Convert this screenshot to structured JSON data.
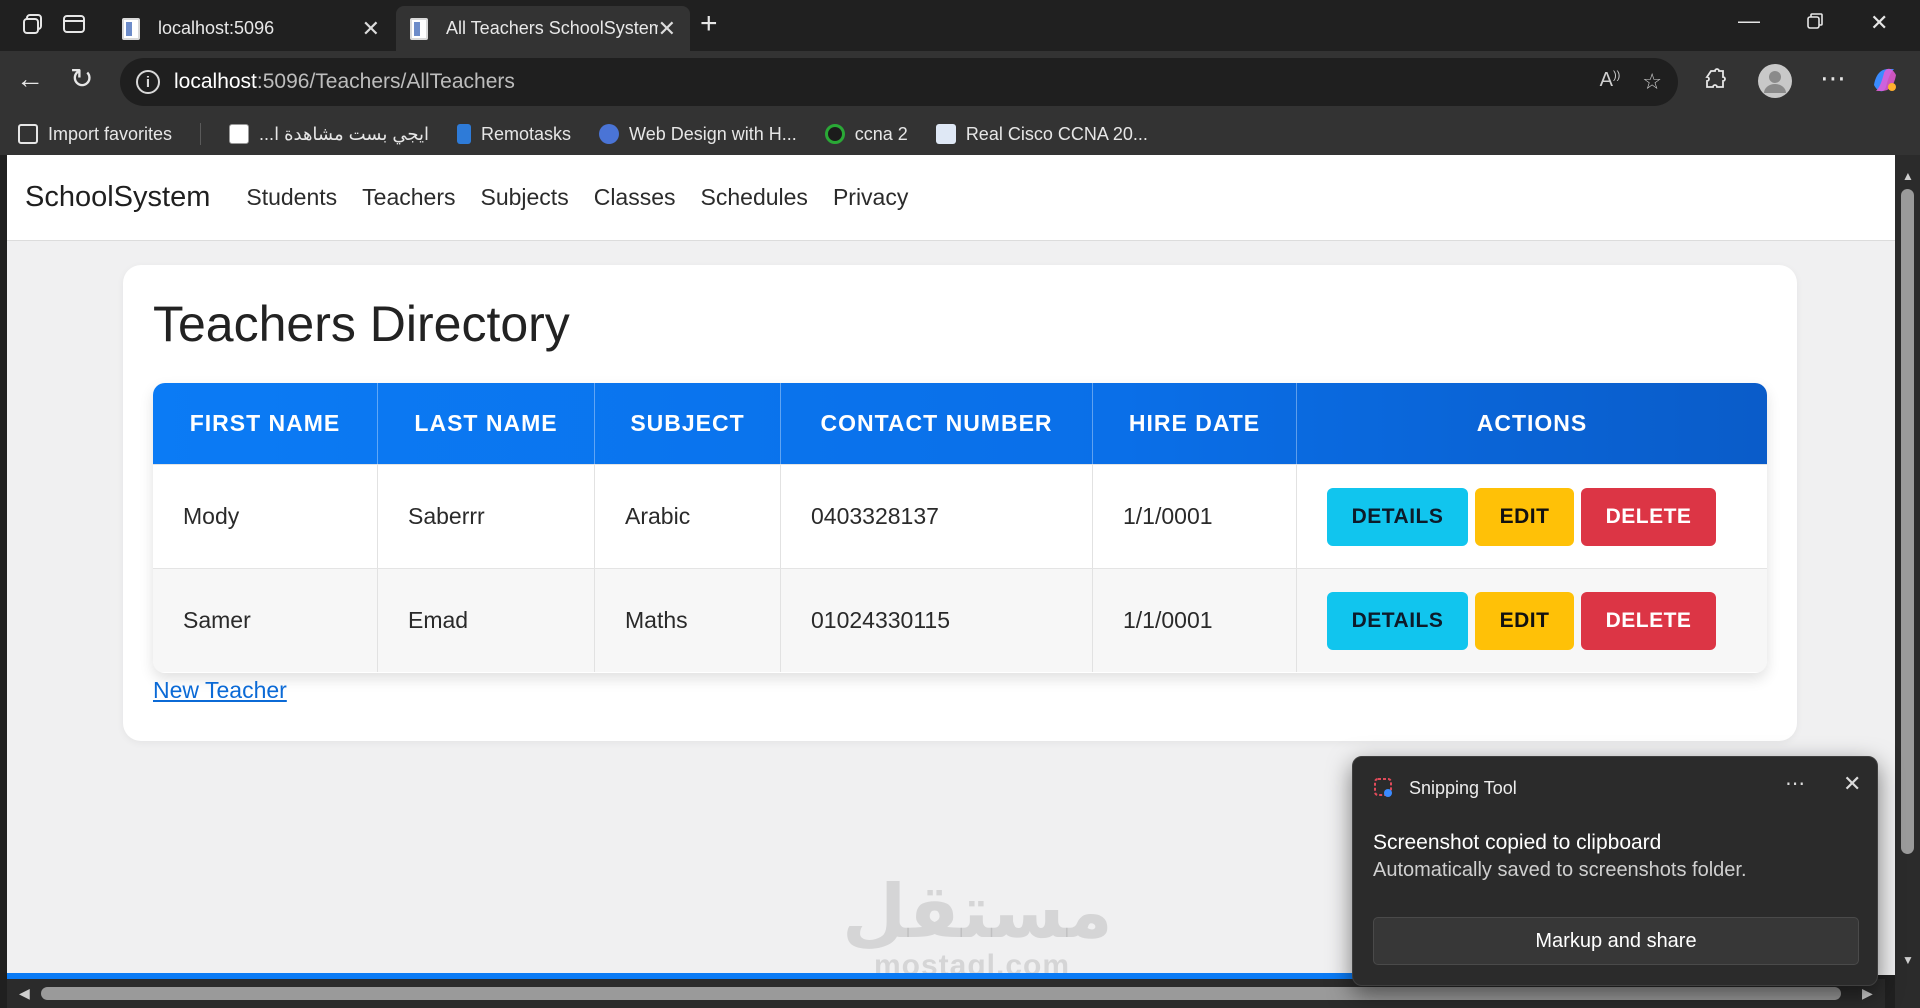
{
  "browser": {
    "tabs": [
      {
        "title": "localhost:5096",
        "active": false
      },
      {
        "title": "All Teachers SchoolSystem",
        "active": true
      }
    ],
    "new_tab_icon": "plus-icon",
    "url_host": "localhost",
    "url_path": ":5096/Teachers/AllTeachers",
    "favorites": [
      {
        "label": "Import favorites"
      },
      {
        "label": "...ايجي بست مشاهدة ا"
      },
      {
        "label": "Remotasks"
      },
      {
        "label": "Web Design with H..."
      },
      {
        "label": "ccna 2"
      },
      {
        "label": "Real Cisco CCNA 20..."
      }
    ]
  },
  "site": {
    "brand": "SchoolSystem",
    "nav": [
      "Students",
      "Teachers",
      "Subjects",
      "Classes",
      "Schedules",
      "Privacy"
    ]
  },
  "page": {
    "title": "Teachers Directory",
    "table": {
      "headers": [
        "FIRST NAME",
        "LAST NAME",
        "SUBJECT",
        "CONTACT NUMBER",
        "HIRE DATE",
        "ACTIONS"
      ],
      "rows": [
        {
          "first": "Mody",
          "last": "Saberrr",
          "subject": "Arabic",
          "contact": "0403328137",
          "hire": "1/1/0001"
        },
        {
          "first": "Samer",
          "last": "Emad",
          "subject": "Maths",
          "contact": "01024330115",
          "hire": "1/1/0001"
        }
      ],
      "actions": {
        "details": "DETAILS",
        "edit": "EDIT",
        "delete": "DELETE"
      }
    },
    "new_link": "New Teacher"
  },
  "watermark": {
    "arabic": "مستقل",
    "latin": "mostaql.com"
  },
  "toast": {
    "app": "Snipping Tool",
    "title": "Screenshot copied to clipboard",
    "subtitle": "Automatically saved to screenshots folder.",
    "button": "Markup and share"
  },
  "colors": {
    "header_blue": "#0b7bf5",
    "details": "#11c5ee",
    "edit": "#ffc107",
    "delete": "#dc3545",
    "link": "#0b6ad6"
  }
}
